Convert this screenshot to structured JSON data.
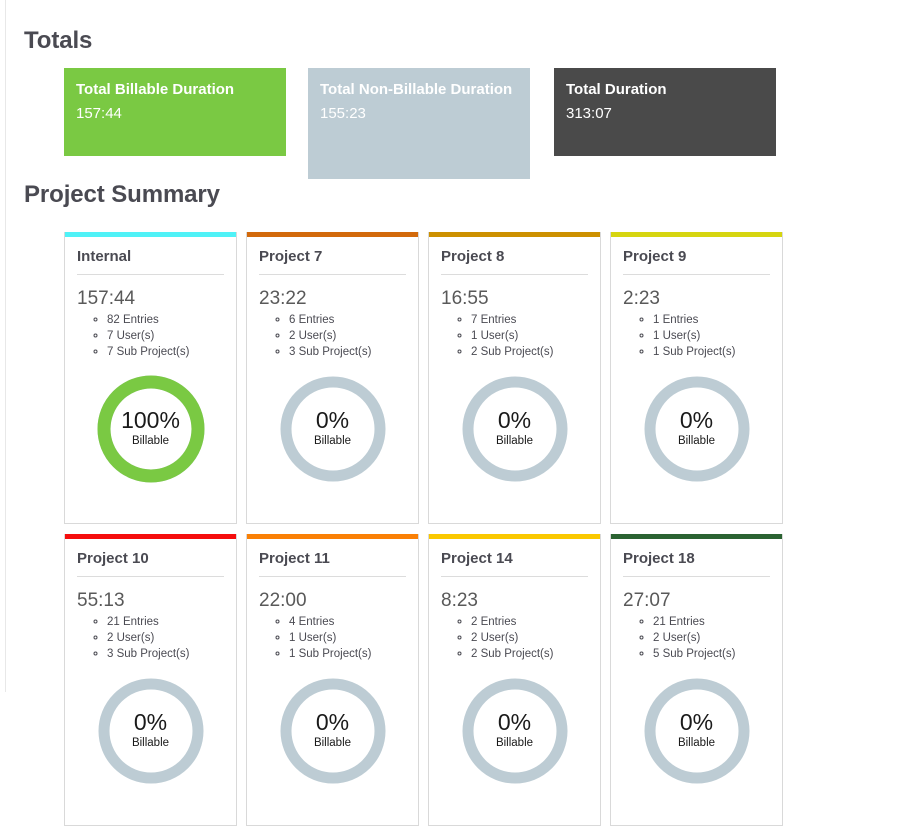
{
  "sections": {
    "totals_heading": "Totals",
    "summary_heading": "Project Summary"
  },
  "totals": {
    "billable": {
      "label": "Total Billable Duration",
      "value": "157:44",
      "color": "#7ac943"
    },
    "non_billable": {
      "label": "Total Non-Billable Duration",
      "value": "155:23",
      "color": "#bdccd4"
    },
    "total": {
      "label": "Total Duration",
      "value": "313:07",
      "color": "#4a4a4a"
    }
  },
  "donut": {
    "billable_suffix": "Billable",
    "fill_color": "#7ac943",
    "track_color": "#bdccd4"
  },
  "projects": [
    {
      "name": "Internal",
      "accent": "#4ff2f7",
      "duration": "157:44",
      "entries": "82 Entries",
      "users": "7 User(s)",
      "sub_projects": "7 Sub Project(s)",
      "billable_percent": 100,
      "billable_percent_label": "100%"
    },
    {
      "name": "Project 7",
      "accent": "#d2690b",
      "duration": "23:22",
      "entries": "6 Entries",
      "users": "2 User(s)",
      "sub_projects": "3 Sub Project(s)",
      "billable_percent": 0,
      "billable_percent_label": "0%"
    },
    {
      "name": "Project 8",
      "accent": "#cc9000",
      "duration": "16:55",
      "entries": "7 Entries",
      "users": "1 User(s)",
      "sub_projects": "2 Sub Project(s)",
      "billable_percent": 0,
      "billable_percent_label": "0%"
    },
    {
      "name": "Project 9",
      "accent": "#d6d510",
      "duration": "2:23",
      "entries": "1 Entries",
      "users": "1 User(s)",
      "sub_projects": "1 Sub Project(s)",
      "billable_percent": 0,
      "billable_percent_label": "0%"
    },
    {
      "name": "Project 10",
      "accent": "#f50d0d",
      "duration": "55:13",
      "entries": "21 Entries",
      "users": "2 User(s)",
      "sub_projects": "3 Sub Project(s)",
      "billable_percent": 0,
      "billable_percent_label": "0%"
    },
    {
      "name": "Project 11",
      "accent": "#fa8005",
      "duration": "22:00",
      "entries": "4 Entries",
      "users": "1 User(s)",
      "sub_projects": "1 Sub Project(s)",
      "billable_percent": 0,
      "billable_percent_label": "0%"
    },
    {
      "name": "Project 14",
      "accent": "#fac800",
      "duration": "8:23",
      "entries": "2 Entries",
      "users": "2 User(s)",
      "sub_projects": "2 Sub Project(s)",
      "billable_percent": 0,
      "billable_percent_label": "0%"
    },
    {
      "name": "Project 18",
      "accent": "#2b6332",
      "duration": "27:07",
      "entries": "21 Entries",
      "users": "2 User(s)",
      "sub_projects": "5 Sub Project(s)",
      "billable_percent": 0,
      "billable_percent_label": "0%"
    }
  ]
}
